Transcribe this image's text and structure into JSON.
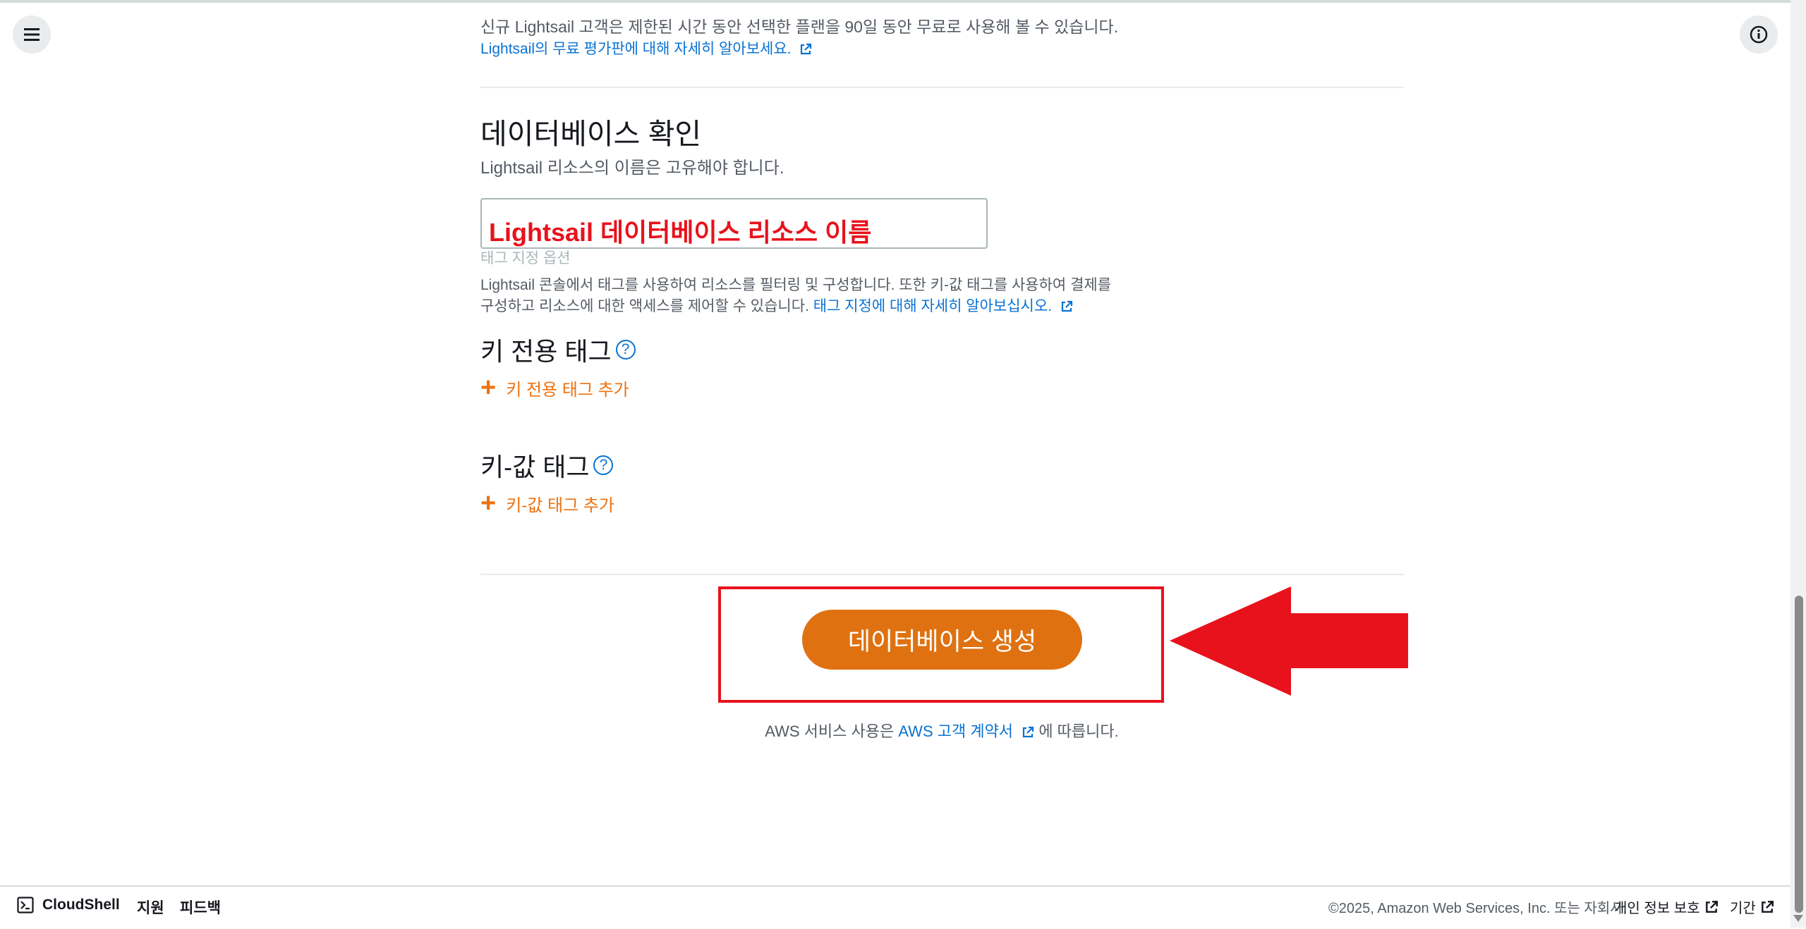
{
  "intro": {
    "line1": "신규 Lightsail 고객은 제한된 시간 동안 선택한 플랜을 90일 동안 무료로 사용해 볼 수 있습니다.",
    "link": "Lightsail의 무료 평가판에 대해 자세히 알아보세요."
  },
  "confirm": {
    "heading": "데이터베이스 확인",
    "desc": "Lightsail 리소스의 이름은 고유해야 합니다.",
    "input_value": "Lightsail 데이터베이스 리소스 이름"
  },
  "tags": {
    "option_label": "태그 지정 옵션",
    "desc_line1": "Lightsail 콘솔에서 태그를 사용하여 리소스를 필터링 및 구성합니다. 또한 키-값 태그를 사용하여 결제를",
    "desc_line2": "구성하고 리소스에 대한 액세스를 제어할 수 있습니다.",
    "desc_link": "태그 지정에 대해 자세히 알아보십시오.",
    "key_only_heading": "키 전용 태그",
    "key_only_add": "키 전용 태그 추가",
    "key_value_heading": "키-값 태그",
    "key_value_add": "키-값 태그 추가",
    "help_glyph": "?"
  },
  "create_button": "데이터베이스 생성",
  "terms": {
    "prefix": "AWS 서비스 사용은",
    "link": "AWS 고객 계약서",
    "suffix": "에 따릅니다."
  },
  "footer": {
    "cloudshell": "CloudShell",
    "support": "지원",
    "feedback": "피드백",
    "copyright": "©2025, Amazon Web Services, Inc. 또는 자회사.",
    "privacy": "개인 정보 보호",
    "terms": "기간"
  },
  "icons": {
    "menu": "hamburger-menu-icon",
    "info": "info-icon",
    "external": "external-link-icon",
    "arrow": "red-arrow-annotation",
    "cloudshell": "terminal-icon"
  },
  "colors": {
    "accent_orange": "#e07110",
    "link_blue": "#0972d3",
    "annotation_red": "#e8121c"
  }
}
